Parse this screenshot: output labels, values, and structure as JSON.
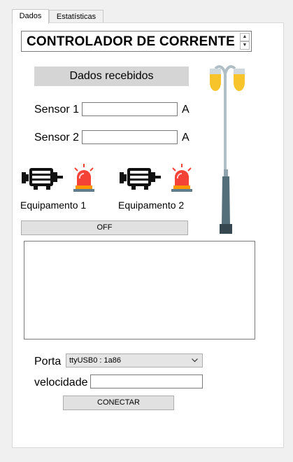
{
  "tabs": [
    "Dados",
    "Estatísticas"
  ],
  "title": "CONTROLADOR DE CORRENTE",
  "received_header": "Dados recebidos",
  "sensors": [
    {
      "label": "Sensor 1",
      "value": "",
      "unit": "A"
    },
    {
      "label": "Sensor 2",
      "value": "",
      "unit": "A"
    }
  ],
  "equipment": [
    {
      "label": "Equipamento 1"
    },
    {
      "label": "Equipamento 2"
    }
  ],
  "toggle_button": "OFF",
  "log_text": "",
  "port": {
    "label": "Porta",
    "selected": "ttyUSB0 : 1a86"
  },
  "speed": {
    "label": "velocidade",
    "value": ""
  },
  "connect_button": "CONECTAR",
  "icons": {
    "motor": "motor-icon",
    "alarm": "siren-icon",
    "lamp": "street-lamp-icon",
    "spin_up": "arrow-up-icon",
    "spin_down": "arrow-down-icon",
    "combo_arrow": "chevron-down-icon"
  },
  "colors": {
    "siren_red": "#f44336",
    "siren_base": "#ff9800",
    "lamp_light": "#f7c42b"
  }
}
